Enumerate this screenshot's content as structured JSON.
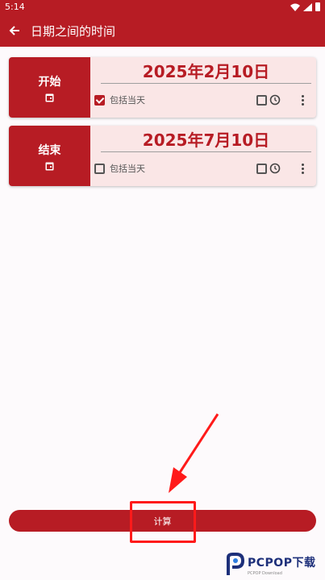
{
  "status_bar": {
    "time": "5:14"
  },
  "app_bar": {
    "back_icon": "arrow-left-icon",
    "title": "日期之间的时间"
  },
  "start_card": {
    "label": "开始",
    "date": "2025年2月10日",
    "include_day_label": "包括当天",
    "include_day_checked": true
  },
  "end_card": {
    "label": "结束",
    "date": "2025年7月10日",
    "include_day_label": "包括当天",
    "include_day_checked": false
  },
  "calculate_button": {
    "label": "计算"
  },
  "watermark": {
    "brand": "PCPOP下载",
    "sub": "PCPOP Download"
  },
  "colors": {
    "primary": "#b71c24",
    "card_bg": "#fae6e6",
    "annotation": "#ff1a1a"
  }
}
